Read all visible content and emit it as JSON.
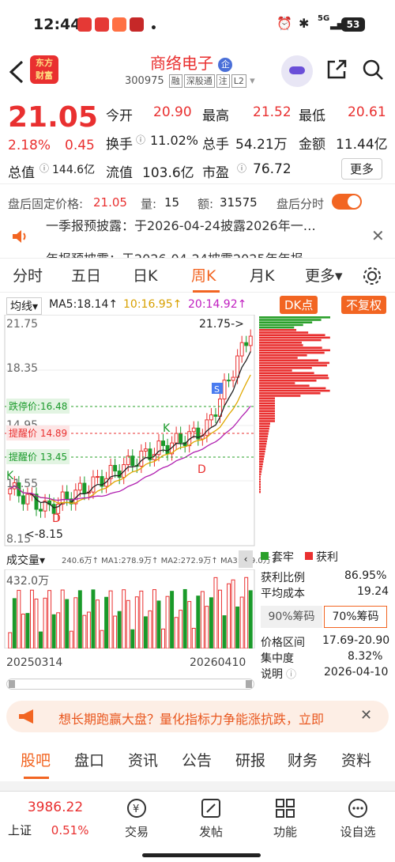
{
  "status": {
    "time": "12:44",
    "battery": "53",
    "network": "5G"
  },
  "header": {
    "logo_line1": "东方",
    "logo_line2": "财富",
    "stock_name": "商络电子",
    "badge": "企",
    "stock_code": "300975",
    "tags": [
      "融",
      "深股通",
      "注",
      "L2"
    ]
  },
  "quote": {
    "price": "21.05",
    "change_pct": "2.18%",
    "change": "0.45",
    "open_label": "今开",
    "open": "20.90",
    "high_label": "最高",
    "high": "21.52",
    "low_label": "最低",
    "low": "20.61",
    "turnover_label": "换手",
    "turnover": "11.02%",
    "volume_label": "总手",
    "volume": "54.21万",
    "amount_label": "金额",
    "amount": "11.44亿",
    "mcap_label": "总值",
    "mcap": "144.6亿",
    "float_label": "流值",
    "float": "103.6亿",
    "pe_label": "市盈",
    "pe": "76.72",
    "more": "更多"
  },
  "afterhours": {
    "price_label": "盘后固定价格:",
    "price": "21.05",
    "qty_label": "量:",
    "qty": "15",
    "amt_label": "额:",
    "amt": "31575",
    "timeshare_label": "盘后分时"
  },
  "news": {
    "line1": "一季报预披露：于2026-04-24披露2026年一…",
    "line2": "年报预披露：于2026-04-24披露2025年年报"
  },
  "period_tabs": [
    "分时",
    "五日",
    "日K",
    "周K",
    "月K",
    "更多▾"
  ],
  "chart": {
    "ma_label": "均线",
    "ma5": "MA5:18.14↑",
    "ma10": "10:16.95↑",
    "ma20": "20:14.92↑",
    "dk_button": "DK点",
    "fq_button": "不复权",
    "price_top": "21.75",
    "price_mid": "18.35",
    "price_1": "14.95",
    "price_2": "11.55",
    "price_bottom": "8.15",
    "top_marker": "21.75->",
    "bottom_marker": "<-8.15",
    "limitdown_label": "跌停价:16.48",
    "alert1": "提醒价 14.89",
    "alert2": "提醒价 13.45",
    "vol_select": "成交量",
    "vol_ma_line": "240.6万↑ MA1:278.9万↑ MA2:272.9万↑ MA3:199.0万↓",
    "vol_max": "432.0万",
    "date_start": "20250314",
    "date_end": "20260410",
    "legend_trapped": "套牢",
    "legend_profit": "获利",
    "profit_ratio_label": "获利比例",
    "profit_ratio": "86.95%",
    "avg_cost_label": "平均成本",
    "avg_cost": "19.24",
    "chip90": "90%筹码",
    "chip70": "70%筹码",
    "price_range_label": "价格区间",
    "price_range": "17.69-20.90",
    "concentration_label": "集中度",
    "concentration": "8.32%",
    "note_label": "说明",
    "note_date": "2026-04-10"
  },
  "promo": {
    "text": "想长期跑赢大盘？量化指标力争能涨抗跌，立即"
  },
  "bottom_tabs": [
    "股吧",
    "盘口",
    "资讯",
    "公告",
    "研报",
    "财务",
    "资料"
  ],
  "nav": {
    "index_value": "3986.22",
    "index_name": "上证",
    "index_change": "0.51%",
    "items": [
      "交易",
      "发帖",
      "功能",
      "设自选"
    ]
  },
  "colors": {
    "up": "#e93030",
    "down": "#1a9a2a",
    "accent": "#f26522"
  },
  "chart_data": {
    "type": "candlestick",
    "bars_count": 56,
    "price_axis": [
      8.15,
      21.75
    ],
    "ma_values": {
      "MA5": 18.14,
      "MA10": 16.95,
      "MA20": 14.92
    }
  }
}
